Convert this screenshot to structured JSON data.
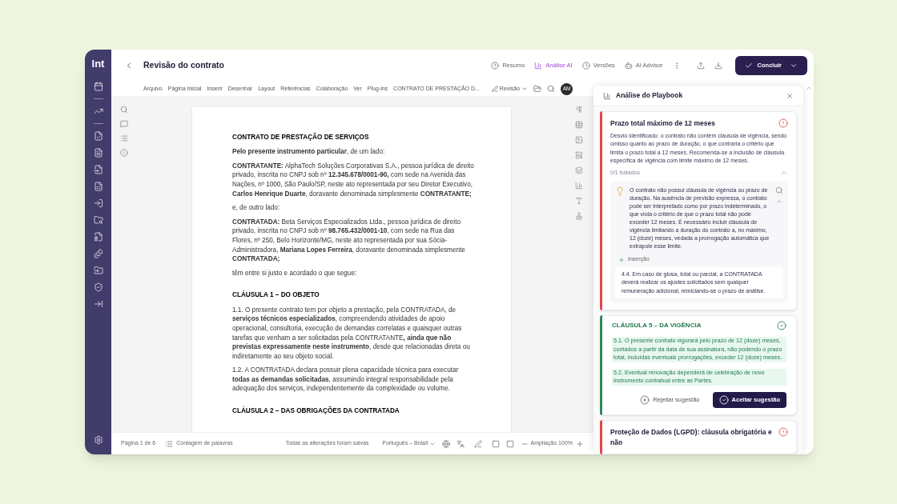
{
  "app": {
    "logo": "lnt"
  },
  "header": {
    "title": "Revisão do contrato",
    "nav": [
      {
        "label": "Resumo",
        "selected": false
      },
      {
        "label": "Análise AI",
        "selected": true
      },
      {
        "label": "Versões",
        "selected": false
      },
      {
        "label": "AI Advisor",
        "selected": false
      }
    ],
    "primary_button": "Concluir"
  },
  "toolbar": {
    "menus": [
      "Arquivo",
      "Página Inicial",
      "Inserir",
      "Desenhar",
      "Layout",
      "Referências",
      "Colaboração",
      "Ver",
      "Plug-ins"
    ],
    "document_name": "CONTRATO DE PRESTAÇÃO D...",
    "mode": "Revisão",
    "avatar": "AM"
  },
  "document": {
    "paragraphs": [
      {
        "kind": "title",
        "text": "CONTRATO DE PRESTAÇÃO DE SERVIÇOS"
      },
      {
        "kind": "para",
        "text": "**Pelo presente instrumento particular**, de um lado:"
      },
      {
        "kind": "para",
        "text": "**CONTRATANTE:** AlphaTech Soluções Corporativas S.A., pessoa jurídica de direito privado, inscrita no CNPJ sob nº **12.345.678/0001-90,** com sede na Avenida das Nações, nº 1000, São Paulo/SP, neste ato representada por seu Diretor Executivo, **Carlos Henrique Duarte**, doravante denominada simplesmente **CONTRATANTE;**"
      },
      {
        "kind": "para",
        "text": "e, de outro lado:"
      },
      {
        "kind": "para",
        "text": "**CONTRATADA:** Beta Serviços Especializados Ltda., pessoa jurídica de direito privado, inscrita no CNPJ sob nº **98.765.432/0001-10**, com sede na Rua das Flores, nº 250, Belo Horizonte/MG, neste ato representada por sua Sócia-Administradora, **Mariana Lopes Ferreira**, doravante denominada simplesmente **CONTRATADA;**"
      },
      {
        "kind": "para",
        "text": "têm entre si justo e acordado o que segue:"
      },
      {
        "kind": "heading",
        "text": "CLÁUSULA 1 – DO OBJETO"
      },
      {
        "kind": "para",
        "text": "1.1. O presente contrato tem por objeto a prestação, pela CONTRATADA, de **serviços técnicos especializados**, compreendendo atividades de apoio operacional, consultoria, execução de demandas correlatas e quaisquer outras tarefas que venham a ser solicitadas pela CONTRATANTE**, ainda que não previstas expressamente neste instrumento**, desde que relacionadas direta ou indiretamente ao seu objeto social."
      },
      {
        "kind": "para",
        "text": "1.2. A CONTRATADA declara possuir plena capacidade técnica para executar **todas as demandas solicitadas**, assumindo integral responsabilidade pela adequação dos serviços, independentemente da complexidade ou volume."
      },
      {
        "kind": "heading",
        "text": "CLÁUSULA 2 – DAS OBRIGAÇÕES DA CONTRATADA"
      }
    ]
  },
  "status_bar": {
    "page": "Página 1 de 6",
    "word_count": "Contagem de palavras",
    "saved": "Todas as alterações foram salvas",
    "language": "Português – Brasil",
    "zoom": "Ampliação 100%"
  },
  "panel": {
    "title": "Análise do Playbook",
    "cards": [
      {
        "kind": "issue",
        "color": "#e5484d",
        "title": "Prazo total máximo de 12 meses",
        "description": "Desvio identificado: o contrato não contém cláusula de vigência, sendo omisso quanto ao prazo de duração, o que contraria o critério que limita o prazo total a 12 meses. Recomenda-se a inclusão de cláusula específica de vigência com limite máximo de 12 meses.",
        "progress": "0/1 tratados",
        "expanded": true,
        "suggestion": {
          "text": "O contrato não possui cláusula de vigência ou prazo de duração. Na ausência de previsão expressa, o contrato pode ser interpretado como por prazo indeterminado, o que viola o critério de que o prazo total não pode exceder 12 meses. É necessário incluir cláusula de vigência limitando a duração do contrato a, no máximo, 12 (doze) meses, vedada a prorrogação automática que extrapole esse limite.",
          "action": "Inserção",
          "quote": "4.4. Em caso de glosa, total ou parcial, a CONTRATADA deverá realizar os ajustes solicitados sem qualquer remuneração adicional, reiniciando-se o prazo de análise."
        }
      },
      {
        "kind": "clause",
        "color": "#2f8a5b",
        "title": "CLÁUSULA 5 – DA VIGÊNCIA",
        "paragraphs": [
          "5.1. O presente contrato vigorará pelo prazo de 12 (doze) meses, contados a partir da data de sua assinatura, não podendo o prazo total, incluídas eventuais prorrogações, exceder 12 (doze) meses.",
          "5.2. Eventual renovação dependerá de celebração de novo instrumento contratual entre as Partes."
        ],
        "reject": "Rejeitar sugestão",
        "accept": "Aceitar sugestão"
      },
      {
        "kind": "issue",
        "color": "#e5484d",
        "title": "Proteção de Dados (LGPD): cláusula obrigatória e não"
      }
    ]
  }
}
